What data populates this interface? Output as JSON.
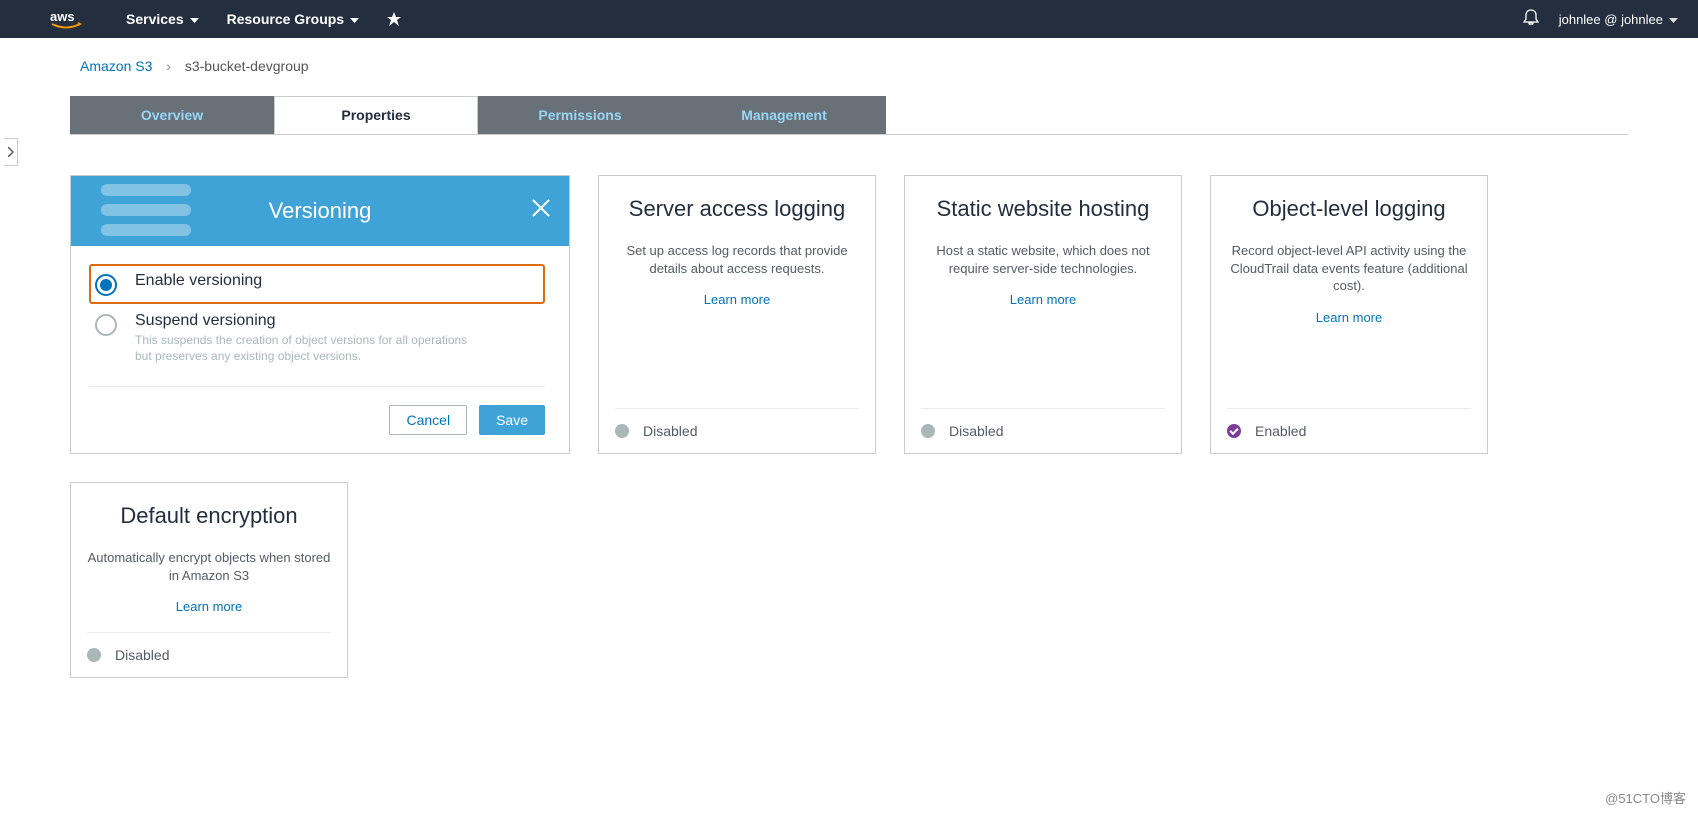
{
  "nav": {
    "services": "Services",
    "resource_groups": "Resource Groups",
    "user": "johnlee @ johnlee"
  },
  "breadcrumb": {
    "root": "Amazon S3",
    "current": "s3-bucket-devgroup"
  },
  "tabs": {
    "overview": "Overview",
    "properties": "Properties",
    "permissions": "Permissions",
    "management": "Management"
  },
  "versioning": {
    "title": "Versioning",
    "enable_label": "Enable versioning",
    "suspend_label": "Suspend versioning",
    "suspend_desc": "This suspends the creation of object versions for all operations but preserves any existing object versions.",
    "cancel": "Cancel",
    "save": "Save"
  },
  "cards": {
    "access_logging": {
      "title": "Server access logging",
      "desc": "Set up access log records that provide details about access requests.",
      "learn": "Learn more",
      "status": "Disabled"
    },
    "static_hosting": {
      "title": "Static website hosting",
      "desc": "Host a static website, which does not require server-side technologies.",
      "learn": "Learn more",
      "status": "Disabled"
    },
    "object_logging": {
      "title": "Object-level logging",
      "desc": "Record object-level API activity using the CloudTrail data events feature (additional cost).",
      "learn": "Learn more",
      "status": "Enabled"
    },
    "encryption": {
      "title": "Default encryption",
      "desc": "Automatically encrypt objects when stored in Amazon S3",
      "learn": "Learn more",
      "status": "Disabled"
    }
  },
  "watermark": "@51CTO博客"
}
